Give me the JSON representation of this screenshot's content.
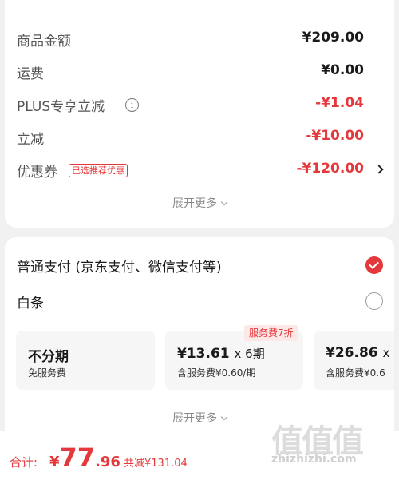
{
  "summary": {
    "rows": [
      {
        "label": "商品金额",
        "value": "¥209.00"
      },
      {
        "label": "运费",
        "value": "¥0.00"
      },
      {
        "label": "PLUS专享立减",
        "value": "-¥1.04",
        "info_icon": "ⓘ"
      },
      {
        "label": "立减",
        "value": "-¥10.00"
      },
      {
        "label": "优惠券",
        "value": "-¥120.00",
        "tag": "已选推荐优惠"
      }
    ],
    "expand_label": "展开更多"
  },
  "payment": {
    "options": [
      {
        "label": "普通支付 (京东支付、微信支付等)",
        "selected": true
      },
      {
        "label": "白条",
        "selected": false
      }
    ],
    "badge": "服务费7折",
    "plans": [
      {
        "main": "不分期",
        "sub": "免服务费"
      },
      {
        "amount": "¥13.61",
        "times": "x 6期",
        "sub": "含服务费¥0.60/期"
      },
      {
        "amount": "¥26.86",
        "times": "x",
        "sub": "含服务费¥0.6"
      }
    ],
    "expand_label": "展开更多"
  },
  "footer": {
    "total_label": "合计:",
    "yen": "¥",
    "total_int": "77",
    "total_dec": ".96",
    "saved": "共减¥131.04"
  },
  "watermark": {
    "glyphs": "值值值",
    "url": "zhizhizhi.com"
  },
  "colors": {
    "accent_red": "#e4393c",
    "background": "#f1f1f1"
  }
}
